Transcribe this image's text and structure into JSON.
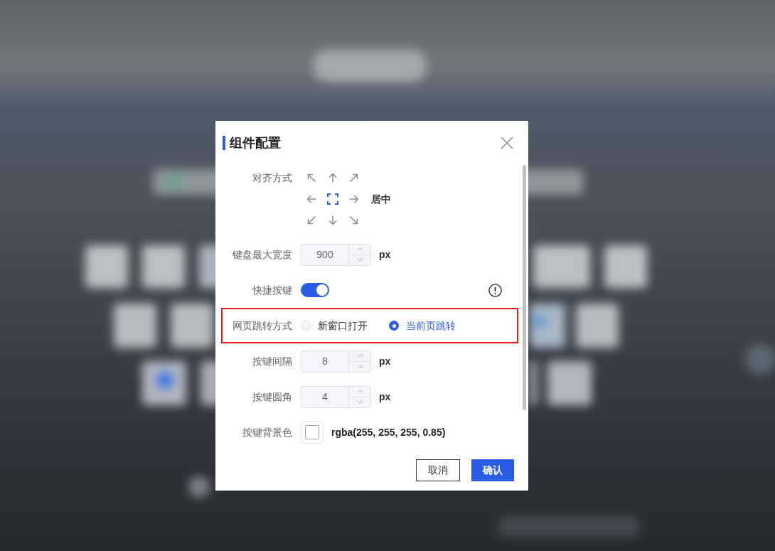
{
  "dialog": {
    "title": "组件配置",
    "fields": [
      {
        "kind": "alignment",
        "label": "对齐方式",
        "options": [
          {
            "selected": false
          },
          {
            "selected": false
          },
          {
            "selected": false
          },
          {
            "selected": false
          },
          {
            "selected": true
          },
          {
            "selected": false
          },
          {
            "selected": false
          },
          {
            "selected": false
          },
          {
            "selected": false
          }
        ],
        "value": "居中"
      },
      {
        "kind": "number",
        "label": "键盘最大宽度",
        "value": "900",
        "unit": "px"
      },
      {
        "kind": "toggle",
        "label": "快捷按键",
        "on": true
      },
      {
        "kind": "radio",
        "label": "网页跳转方式",
        "highlighted": true,
        "options": [
          {
            "label": "新窗口打开",
            "selected": false
          },
          {
            "label": "当前页跳转",
            "selected": true
          }
        ]
      },
      {
        "kind": "number",
        "label": "按键间隔",
        "value": "8",
        "unit": "px"
      },
      {
        "kind": "number",
        "label": "按键圆角",
        "value": "4",
        "unit": "px"
      },
      {
        "kind": "color",
        "label": "按键背景色",
        "value": "rgba(255, 255, 255, 0.85)"
      }
    ],
    "buttons": [
      {
        "label": "取消",
        "kind": "secondary"
      },
      {
        "label": "确认",
        "kind": "primary"
      }
    ]
  }
}
